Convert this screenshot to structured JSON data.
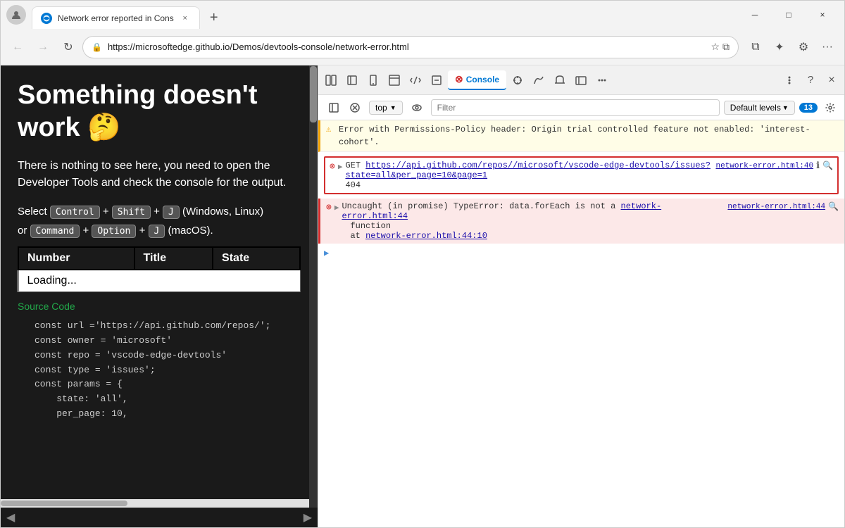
{
  "browser": {
    "tab": {
      "title": "Network error reported in Cons",
      "close_label": "×",
      "new_tab_label": "+"
    },
    "controls": {
      "minimize": "─",
      "maximize": "□",
      "close": "×"
    },
    "nav": {
      "back": "←",
      "forward": "→",
      "refresh": "↺"
    },
    "url": "https://microsoftedge.github.io/Demos/devtools-console/network-error.html",
    "toolbar_icons": [
      "🖼",
      "⚙",
      "⭐",
      "⧉",
      "☰"
    ]
  },
  "webpage": {
    "heading": "Something doesn't work 🤔",
    "body_text": "There is nothing to see here, you need to open the Developer Tools and check the console for the output.",
    "keyboard_hint1": "Select",
    "key1": "Control",
    "plus1": "+",
    "key2": "Shift",
    "plus2": "+",
    "key3": "J",
    "hint_windows": "(Windows, Linux)",
    "hint_or": "or",
    "key4": "Command",
    "plus3": "+",
    "key5": "Option",
    "plus4": "+",
    "key6": "J",
    "hint_macos": "(macOS).",
    "table": {
      "headers": [
        "Number",
        "Title",
        "State"
      ],
      "loading_text": "Loading..."
    },
    "source_code_label": "Source Code",
    "code_lines": [
      "const url ='https://api.github.com/repos/';",
      "const owner = 'microsoft'",
      "const repo = 'vscode-edge-devtools'",
      "const type = 'issues';",
      "const params = {",
      "    state: 'all',",
      "    per_page: 10,"
    ]
  },
  "devtools": {
    "top_tabs": [
      "Elements",
      "Network",
      "Console",
      "Sources",
      "Performance",
      "Memory",
      "Application",
      "More"
    ],
    "active_tab": "Console",
    "toolbar_icons": {
      "sidebar": "⊟",
      "block": "⊘",
      "context": "top",
      "eye": "👁",
      "filter_placeholder": "Filter",
      "level": "Default levels",
      "badge_count": "13",
      "settings": "⚙"
    },
    "messages": [
      {
        "type": "warning",
        "text": "⚠ Error with Permissions-Policy header: Origin trial controlled feature not enabled: 'interest-cohort'."
      },
      {
        "type": "error-bordered",
        "icon": "🔴",
        "expand": "▶",
        "method": "GET",
        "url": "https://api.github.com/repos//microsoft/vscode-edge-devtools/issues?state=all&per_page=10&page=1",
        "status": "404",
        "source": "network-error.html:40",
        "help": "ℹ",
        "search": "🔍"
      },
      {
        "type": "error",
        "icon": "🔴",
        "expand": "▶",
        "text": "Uncaught (in promise) TypeError: data.forEach is not a function",
        "indent_text": "at",
        "source_inline": "network-error.html:44",
        "source_right": "network-error.html:44",
        "search": "🔍"
      }
    ],
    "arrow": "▶"
  }
}
